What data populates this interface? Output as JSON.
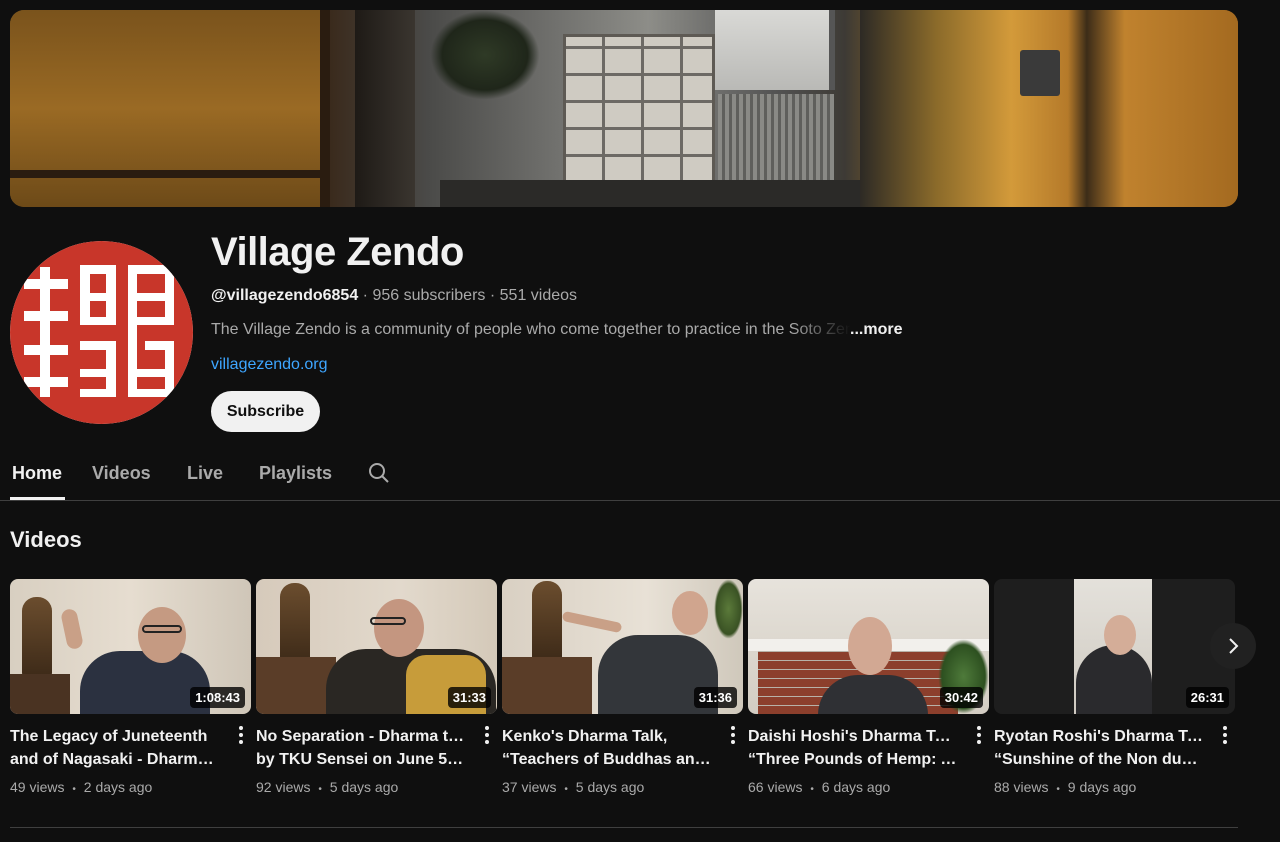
{
  "channel": {
    "name": "Village Zendo",
    "handle": "@villagezendo6854",
    "subscribers": "956 subscribers",
    "videos_count": "551 videos",
    "separator": "·",
    "description": "The Village Zendo is a community of people who come together to practice in the Soto Zen",
    "more_label": "...more",
    "link": "villagezendo.org",
    "subscribe_label": "Subscribe"
  },
  "tabs": [
    {
      "label": "Home",
      "active": true
    },
    {
      "label": "Videos",
      "active": false
    },
    {
      "label": "Live",
      "active": false
    },
    {
      "label": "Playlists",
      "active": false
    }
  ],
  "section_title": "Videos",
  "videos": [
    {
      "title_line1": "The Legacy of Juneteenth",
      "title_line2": "and of Nagasaki - Dharma…",
      "duration": "1:08:43",
      "views": "49 views",
      "age": "2 days ago"
    },
    {
      "title_line1": "No Separation - Dharma talk",
      "title_line2": "by TKU Sensei on June 5,…",
      "duration": "31:33",
      "views": "92 views",
      "age": "5 days ago"
    },
    {
      "title_line1": "Kenko's Dharma Talk,",
      "title_line2": "“Teachers of Buddhas and…",
      "duration": "31:36",
      "views": "37 views",
      "age": "5 days ago"
    },
    {
      "title_line1": "Daishi Hoshi's Dharma Talk,",
      "title_line2": "“Three Pounds of Hemp: An…",
      "duration": "30:42",
      "views": "66 views",
      "age": "6 days ago"
    },
    {
      "title_line1": "Ryotan Roshi's Dharma Talk,",
      "title_line2": "“Sunshine of the Non dual…",
      "duration": "26:31",
      "views": "88 views",
      "age": "9 days ago"
    }
  ],
  "stat_separator": "•",
  "icons": {
    "search": "search-icon",
    "more": "more-vert-icon",
    "next": "chevron-right-icon"
  },
  "colors": {
    "background": "#0f0f0f",
    "link": "#3ea6ff",
    "seal_red": "#c8362a"
  }
}
